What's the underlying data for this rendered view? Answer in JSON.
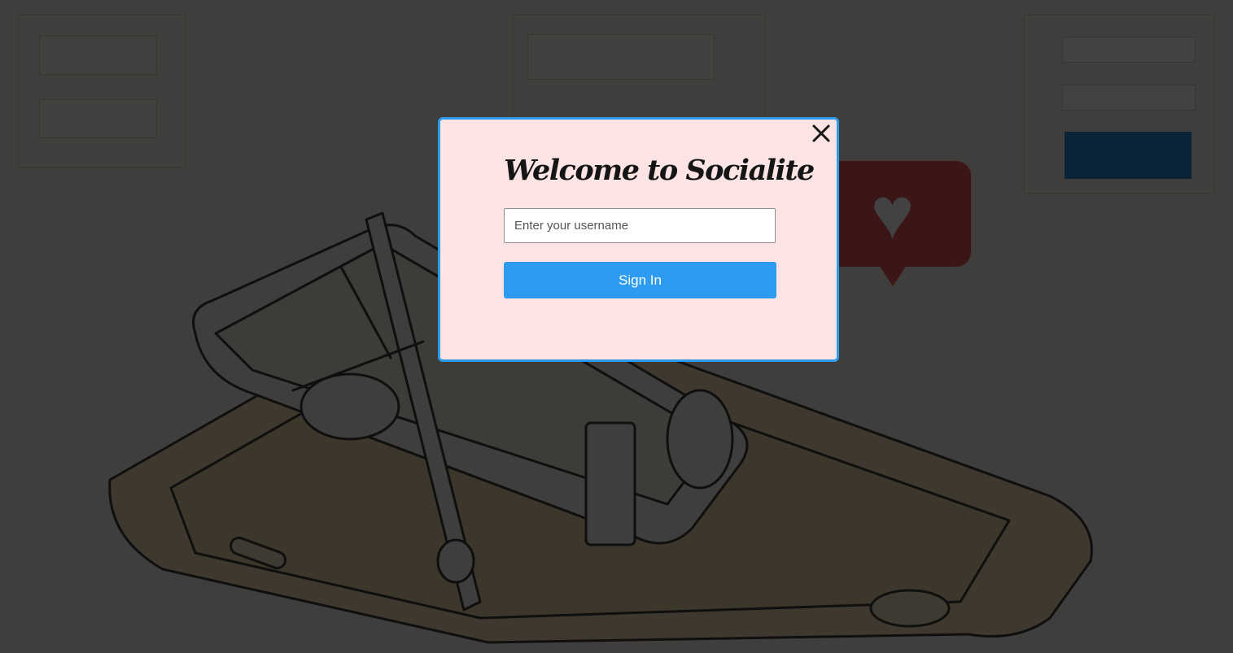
{
  "app": {
    "name": "Socialite"
  },
  "modal": {
    "title": "Welcome to Socialite",
    "username_placeholder": "Enter your username",
    "username_value": "",
    "signin_label": "Sign In",
    "close_icon": "close-icon"
  },
  "colors": {
    "modal_background": "#fde4e4",
    "modal_border": "#2e9ceb",
    "primary_button": "#2d9cf0",
    "overlay": "rgba(0,0,0,0.74)"
  },
  "icons": [
    "close-icon",
    "heart-icon",
    "phone-mousetrap-illustration"
  ]
}
